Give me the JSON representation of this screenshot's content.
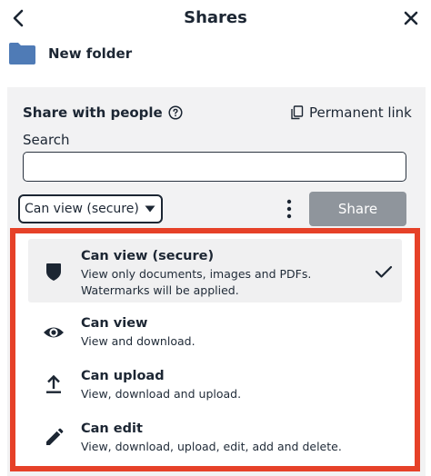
{
  "header": {
    "title": "Shares",
    "back_icon": "chevron-left-icon",
    "close_icon": "close-icon"
  },
  "folder": {
    "name": "New folder",
    "icon": "folder-icon",
    "color": "#4f7bb6"
  },
  "share": {
    "heading": "Share with people",
    "permanent_link": "Permanent link",
    "search_label": "Search",
    "search_value": "",
    "selected_permission": "Can view (secure)",
    "share_button": "Share"
  },
  "permissions": [
    {
      "title": "Can view (secure)",
      "desc_line1": "View only documents, images and PDFs.",
      "desc_line2": "Watermarks will be applied.",
      "icon": "shield-icon",
      "selected": true
    },
    {
      "title": "Can view",
      "desc_line1": "View and download.",
      "icon": "eye-icon",
      "selected": false
    },
    {
      "title": "Can upload",
      "desc_line1": "View, download and upload.",
      "icon": "upload-icon",
      "selected": false
    },
    {
      "title": "Can edit",
      "desc_line1": "View, download, upload, edit, add and delete.",
      "icon": "pencil-icon",
      "selected": false
    }
  ],
  "colors": {
    "highlight_border": "#e64128",
    "share_button_disabled": "#8f959c",
    "panel_bg": "#f2f2f3"
  }
}
